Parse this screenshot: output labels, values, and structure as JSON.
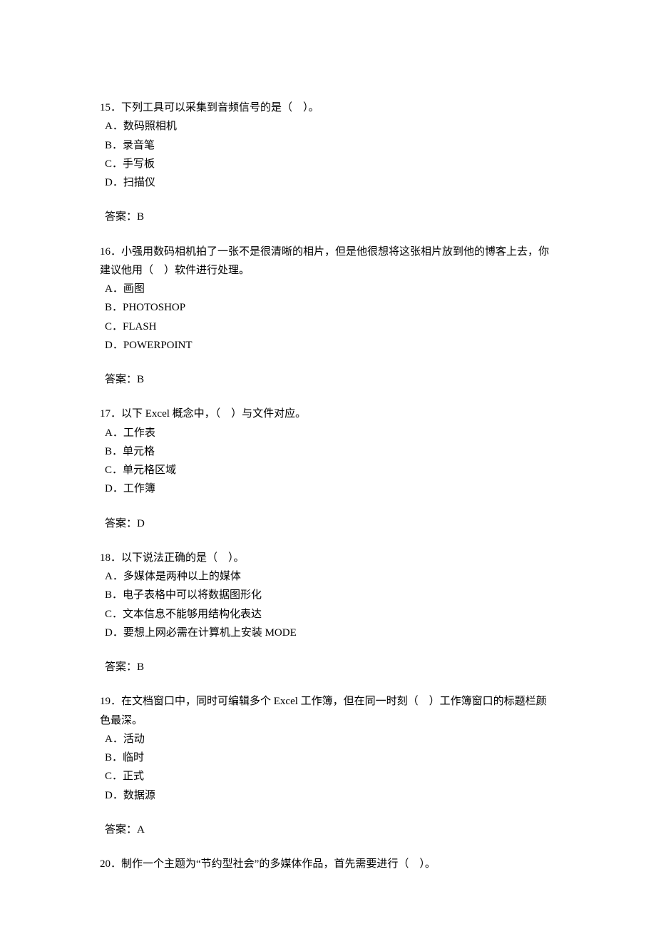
{
  "questions": [
    {
      "num": "15",
      "stem": "．下列工具可以采集到音频信号的是（　）。",
      "opts": [
        "A．数码照相机",
        "B．录音笔",
        "C．手写板",
        "D．扫描仪"
      ],
      "answer": "答案：B"
    },
    {
      "num": "16",
      "stem": "．小强用数码相机拍了一张不是很清晰的相片，但是他很想将这张相片放到他的博客上去，你建议他用（　）软件进行处理。",
      "opts": [
        "A．画图",
        "B．PHOTOSHOP",
        "C．FLASH",
        "D．POWERPOINT"
      ],
      "answer": "答案：B"
    },
    {
      "num": "17",
      "stem_before": "．以下 ",
      "stem_latin": "Excel",
      "stem_after": " 概念中，（　）与文件对应。",
      "opts": [
        "A．工作表",
        "B．单元格",
        "C．单元格区域",
        "D．工作簿"
      ],
      "answer": "答案：D"
    },
    {
      "num": "18",
      "stem": "．以下说法正确的是（　）。",
      "opts": [
        "A．多媒体是两种以上的媒体",
        "B．电子表格中可以将数据图形化",
        "C．文本信息不能够用结构化表达",
        "D．要想上网必需在计算机上安装 MODE"
      ],
      "answer": "答案：B"
    },
    {
      "num": "19",
      "stem_before": "．在文档窗口中，同时可编辑多个 ",
      "stem_latin": "Excel",
      "stem_after": " 工作簿，但在同一时刻（　）工作簿窗口的标题栏颜色最深。",
      "opts": [
        "A．活动",
        "B．临时",
        "C．正式",
        "D．数据源"
      ],
      "answer": "答案：A"
    },
    {
      "num": "20",
      "stem": "．制作一个主题为“节约型社会”的多媒体作品，首先需要进行（　）。"
    }
  ]
}
